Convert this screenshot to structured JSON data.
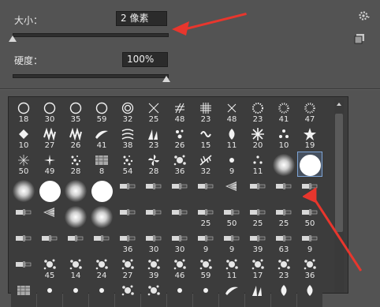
{
  "size": {
    "label": "大小：",
    "value": "2 像素",
    "slider_fraction": 0.0
  },
  "hardness": {
    "label": "硬度：",
    "value": "100%",
    "slider_fraction": 1.0
  },
  "icons": {
    "gear": "gear-icon",
    "new_preset": "new-preset-icon"
  },
  "accent_colors": {
    "annotation_arrow": "#e8362d",
    "selection": "#7da4d6"
  },
  "brushes": [
    {
      "shape": "ring",
      "label": "18"
    },
    {
      "shape": "ring",
      "label": "30"
    },
    {
      "shape": "ring",
      "label": "35"
    },
    {
      "shape": "ring",
      "label": "59"
    },
    {
      "shape": "double-ring",
      "label": "32"
    },
    {
      "shape": "cross-thin",
      "label": "25"
    },
    {
      "shape": "hatch",
      "label": "48"
    },
    {
      "shape": "grid",
      "label": "23"
    },
    {
      "shape": "x-thin",
      "label": "48"
    },
    {
      "shape": "dotted-ring",
      "label": "23"
    },
    {
      "shape": "sun",
      "label": "41"
    },
    {
      "shape": "sun",
      "label": "47"
    },
    {
      "shape": "diamond",
      "label": "10"
    },
    {
      "shape": "zigzag",
      "label": "27"
    },
    {
      "shape": "zigzag",
      "label": "26"
    },
    {
      "shape": "stroke",
      "label": "41"
    },
    {
      "shape": "swirl",
      "label": "38"
    },
    {
      "shape": "grass",
      "label": "23"
    },
    {
      "shape": "drops",
      "label": "26"
    },
    {
      "shape": "wave",
      "label": "15"
    },
    {
      "shape": "leaf",
      "label": "11"
    },
    {
      "shape": "snowflake",
      "label": "20"
    },
    {
      "shape": "dots",
      "label": "10"
    },
    {
      "shape": "star",
      "label": "19"
    },
    {
      "shape": "spark",
      "label": "50"
    },
    {
      "shape": "burst",
      "label": "49"
    },
    {
      "shape": "scatter",
      "label": "28"
    },
    {
      "shape": "texture",
      "label": "8"
    },
    {
      "shape": "scatter",
      "label": "54"
    },
    {
      "shape": "pinwheel",
      "label": "28"
    },
    {
      "shape": "splat",
      "label": "36"
    },
    {
      "shape": "feather",
      "label": "32"
    },
    {
      "shape": "dot",
      "label": "9"
    },
    {
      "shape": "triangle-dots",
      "label": "11"
    },
    {
      "shape": "soft-round",
      "label": ""
    },
    {
      "shape": "hard-round",
      "label": ""
    },
    {
      "shape": "soft-round",
      "label": ""
    },
    {
      "shape": "hard-round",
      "label": ""
    },
    {
      "shape": "soft-round",
      "label": ""
    },
    {
      "shape": "hard-round",
      "label": ""
    },
    {
      "shape": "tool",
      "label": ""
    },
    {
      "shape": "tool",
      "label": ""
    },
    {
      "shape": "tool",
      "label": ""
    },
    {
      "shape": "tool",
      "label": ""
    },
    {
      "shape": "fan",
      "label": ""
    },
    {
      "shape": "tool",
      "label": ""
    },
    {
      "shape": "tool",
      "label": ""
    },
    {
      "shape": "tool",
      "label": ""
    },
    {
      "shape": "tool",
      "label": ""
    },
    {
      "shape": "fan",
      "label": ""
    },
    {
      "shape": "soft-round",
      "label": ""
    },
    {
      "shape": "soft-round",
      "label": ""
    },
    {
      "shape": "tool",
      "label": ""
    },
    {
      "shape": "tool",
      "label": ""
    },
    {
      "shape": "tool",
      "label": ""
    },
    {
      "shape": "tool",
      "label": "25"
    },
    {
      "shape": "tool",
      "label": "50"
    },
    {
      "shape": "tool",
      "label": "25"
    },
    {
      "shape": "tool",
      "label": "25"
    },
    {
      "shape": "tool",
      "label": "50"
    },
    {
      "shape": "tool",
      "label": ""
    },
    {
      "shape": "tool",
      "label": ""
    },
    {
      "shape": "tool",
      "label": ""
    },
    {
      "shape": "tool",
      "label": ""
    },
    {
      "shape": "tool",
      "label": "36"
    },
    {
      "shape": "tool",
      "label": "30"
    },
    {
      "shape": "tool",
      "label": "30"
    },
    {
      "shape": "tool",
      "label": "9"
    },
    {
      "shape": "tool",
      "label": "9"
    },
    {
      "shape": "tool",
      "label": "39"
    },
    {
      "shape": "tool",
      "label": "63"
    },
    {
      "shape": "tool",
      "label": "9"
    },
    {
      "shape": "tool",
      "label": ""
    },
    {
      "shape": "splat",
      "label": "45"
    },
    {
      "shape": "splat",
      "label": "14"
    },
    {
      "shape": "splat",
      "label": "24"
    },
    {
      "shape": "splat",
      "label": "27"
    },
    {
      "shape": "splat",
      "label": "39"
    },
    {
      "shape": "splat",
      "label": "46"
    },
    {
      "shape": "splat",
      "label": "59"
    },
    {
      "shape": "splat",
      "label": "11"
    },
    {
      "shape": "splat",
      "label": "17"
    },
    {
      "shape": "splat",
      "label": "23"
    },
    {
      "shape": "splat",
      "label": "36"
    },
    {
      "shape": "texture",
      "label": ""
    },
    {
      "shape": "dot",
      "label": ""
    },
    {
      "shape": "dot",
      "label": ""
    },
    {
      "shape": "dot",
      "label": ""
    },
    {
      "shape": "splat",
      "label": ""
    },
    {
      "shape": "splat",
      "label": ""
    },
    {
      "shape": "dot",
      "label": ""
    },
    {
      "shape": "dot",
      "label": ""
    },
    {
      "shape": "stroke",
      "label": ""
    },
    {
      "shape": "grass",
      "label": ""
    },
    {
      "shape": "leaf",
      "label": ""
    },
    {
      "shape": "leaf",
      "label": ""
    }
  ]
}
